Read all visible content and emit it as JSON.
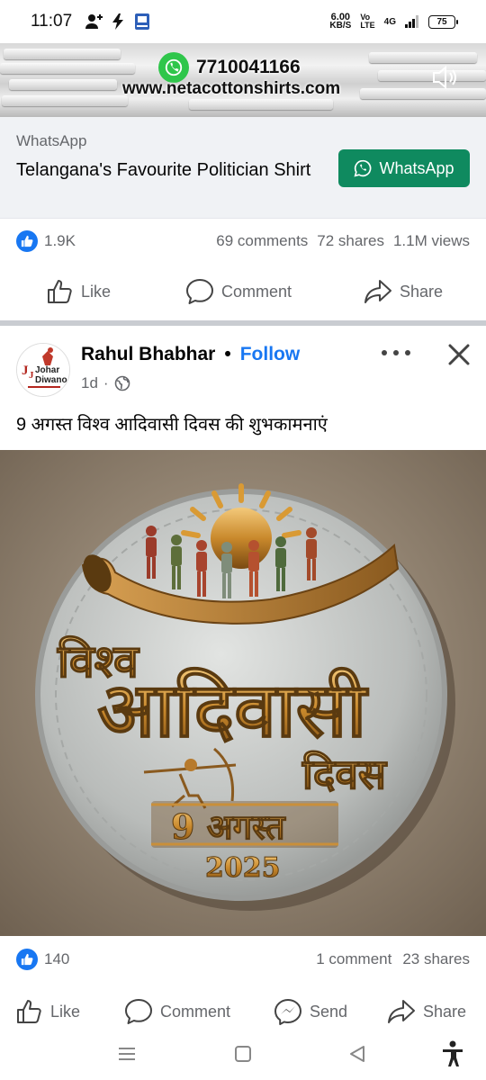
{
  "status_bar": {
    "time": "11:07",
    "net_speed_value": "6.00",
    "net_speed_unit": "KB/S",
    "volte_top": "Vo",
    "volte_bottom": "LTE",
    "network": "4G",
    "battery": "75"
  },
  "ad": {
    "banner": {
      "phone": "7710041166",
      "url": "www.netacottonshirts.com"
    },
    "source": "WhatsApp",
    "title": "Telangana's Favourite Politician Shirt",
    "cta_label": "WhatsApp",
    "stats": {
      "reactions": "1.9K",
      "comments": "69 comments",
      "shares": "72 shares",
      "views": "1.1M views"
    },
    "actions": {
      "like": "Like",
      "comment": "Comment",
      "share": "Share"
    }
  },
  "post": {
    "author": "Rahul Bhabhar",
    "separator": "•",
    "follow_label": "Follow",
    "time": "1d",
    "meta_sep": "·",
    "avatar_text_top": "Johar",
    "avatar_text_bottom": "Diwano",
    "caption": "9 अगस्त विश्व आदिवासी दिवस की शुभकामनाएं",
    "image": {
      "line1": "विश्व",
      "line2": "आदिवासी",
      "line3": "दिवस",
      "date_label": "9 अगस्त",
      "year": "2025"
    },
    "stats": {
      "reactions": "140",
      "comments": "1 comment",
      "shares": "23 shares"
    },
    "actions": {
      "like": "Like",
      "comment": "Comment",
      "send": "Send",
      "share": "Share"
    }
  },
  "colors": {
    "facebook_blue": "#1877f2",
    "whatsapp_green": "#0f8a5f",
    "muted_text": "#65676b"
  }
}
